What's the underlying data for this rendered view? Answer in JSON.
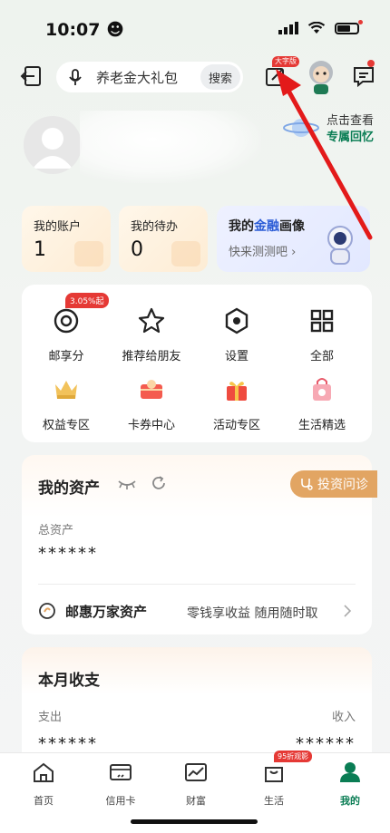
{
  "status_bar": {
    "time": "10:07",
    "time_emoji": "☻"
  },
  "top_bar": {
    "search_placeholder": "养老金大礼包",
    "search_button": "搜索",
    "bigfont_badge": "大字版"
  },
  "profile": {
    "memory_line1": "点击查看",
    "memory_line2": "专属回忆"
  },
  "cards": {
    "account": {
      "label": "我的账户",
      "value": "1"
    },
    "todo": {
      "label": "我的待办",
      "value": "0"
    },
    "portrait": {
      "label_pre": "我的",
      "label_hl": "金融",
      "label_post": "画像",
      "sub": "快来测测吧",
      "hl_color": "#2b5cd6"
    }
  },
  "menu": {
    "rate_badge": "3.05%起",
    "items": [
      {
        "label": "邮享分",
        "icon": "points-icon"
      },
      {
        "label": "推荐给朋友",
        "icon": "star-icon"
      },
      {
        "label": "设置",
        "icon": "settings-icon"
      },
      {
        "label": "全部",
        "icon": "grid-icon"
      },
      {
        "label": "权益专区",
        "icon": "crown-icon"
      },
      {
        "label": "卡券中心",
        "icon": "coupon-icon"
      },
      {
        "label": "活动专区",
        "icon": "gift-icon"
      },
      {
        "label": "生活精选",
        "icon": "shopping-bag-icon"
      }
    ]
  },
  "assets": {
    "title": "我的资产",
    "invest_button": "投资问诊",
    "total_label": "总资产",
    "total_value": "******",
    "wanjia_title": "邮惠万家资产",
    "wanjia_desc": "零钱享收益 随用随时取"
  },
  "monthly": {
    "title": "本月收支",
    "expense_label": "支出",
    "income_label": "收入",
    "expense_value": "******",
    "income_value": "******"
  },
  "bottom_nav": {
    "life_badge": "95折观影",
    "items": [
      {
        "label": "首页"
      },
      {
        "label": "信用卡"
      },
      {
        "label": "财富"
      },
      {
        "label": "生活"
      },
      {
        "label": "我的"
      }
    ]
  },
  "colors": {
    "brand_green": "#0a7d54",
    "accent_red": "#e53935",
    "gold": "#e2a563"
  }
}
